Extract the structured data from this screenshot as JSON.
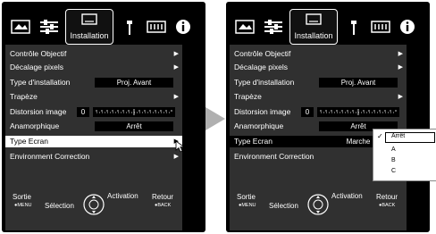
{
  "tabs": {
    "picture_icon": "picture-icon",
    "settings_icon": "sliders-icon",
    "installation_label": "Installation",
    "tools_icon": "wrench-icon",
    "input_icon": "input-icon",
    "info_icon": "info-icon"
  },
  "menu": {
    "items": [
      {
        "label": "Contrôle Objectif",
        "arrow": "▶"
      },
      {
        "label": "Décalage pixels",
        "arrow": "▶"
      },
      {
        "label": "Type d'installation",
        "value": "Proj. Avant"
      },
      {
        "label": "Trapèze",
        "arrow": "▶"
      },
      {
        "label": "Distorsion image",
        "value": "0"
      },
      {
        "label": "Anamorphique",
        "value": "Arrêt"
      },
      {
        "label": "Type Ecran",
        "arrow": "▶"
      },
      {
        "label": "Environment Correction",
        "arrow": "▶"
      }
    ]
  },
  "right_menu": {
    "type_ecran_value": "Marche"
  },
  "dropdown": {
    "options": [
      "Arrêt",
      "A",
      "B",
      "C"
    ],
    "selected": "Arrêt",
    "check": "✓"
  },
  "footer": {
    "sortie": "Sortie",
    "menu_key": "●MENU",
    "selection": "Sélection",
    "activation": "Activation",
    "retour": "Retour",
    "back_key": "●BACK"
  },
  "colors": {
    "background": "#000000",
    "menu_bg": "#303030",
    "highlight": "#ffffff",
    "arrow_gray": "#b0b0b0"
  }
}
